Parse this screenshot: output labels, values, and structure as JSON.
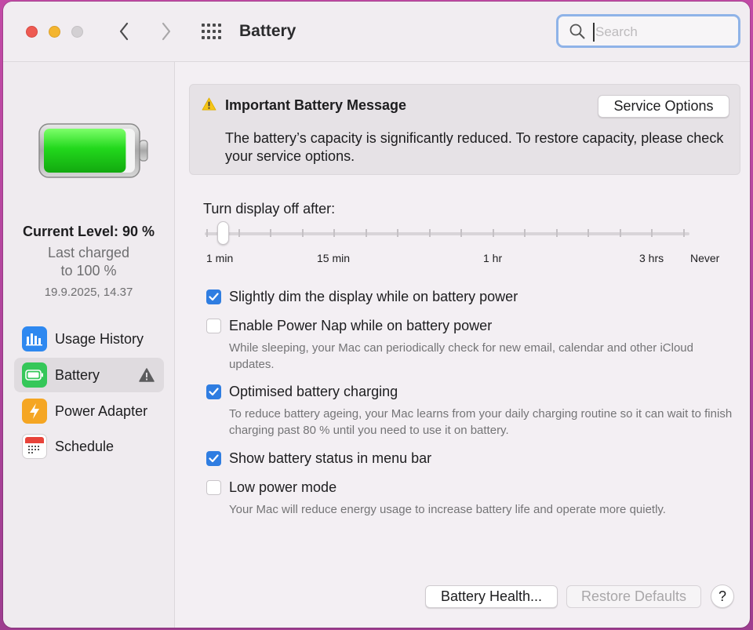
{
  "window": {
    "title": "Battery",
    "search_placeholder": "Search"
  },
  "sidebar": {
    "current_level": "Current Level: 90 %",
    "last_charged": "Last charged",
    "to_level": "to 100 %",
    "charged_date": "19.9.2025, 14.37",
    "battery_level": 0.9,
    "items": [
      {
        "label": "Usage History",
        "icon": "bar-chart-icon",
        "color": "#2e88f0"
      },
      {
        "label": "Battery",
        "icon": "battery-icon",
        "color": "#35c759",
        "selected": true,
        "warning": true
      },
      {
        "label": "Power Adapter",
        "icon": "lightning-icon",
        "color": "#f5a623"
      },
      {
        "label": "Schedule",
        "icon": "calendar-icon",
        "color": "#ffffff"
      }
    ]
  },
  "message": {
    "title": "Important Battery Message",
    "body": "The battery’s capacity is significantly reduced. To restore capacity, please check your service options.",
    "button": "Service Options"
  },
  "display_off": {
    "label": "Turn display off after:",
    "marks": [
      "1 min",
      "15 min",
      "1 hr",
      "3 hrs",
      "Never"
    ],
    "selected": "1 min"
  },
  "options": [
    {
      "label": "Slightly dim the display while on battery power",
      "checked": true
    },
    {
      "label": "Enable Power Nap while on battery power",
      "checked": false,
      "help": "While sleeping, your Mac can periodically check for new email, calendar and other iCloud updates."
    },
    {
      "label": "Optimised battery charging",
      "checked": true,
      "help": "To reduce battery ageing, your Mac learns from your daily charging routine so it can wait to finish charging past 80 % until you need to use it on battery."
    },
    {
      "label": "Show battery status in menu bar",
      "checked": true
    },
    {
      "label": "Low power mode",
      "checked": false,
      "help": "Your Mac will reduce energy usage to increase battery life and operate more quietly."
    }
  ],
  "footer": {
    "battery_health": "Battery Health...",
    "restore_defaults": "Restore Defaults",
    "help": "?"
  },
  "colors": {
    "accent": "#2f7de1",
    "battery_green": "#2ed62e",
    "warning": "#f5c518"
  }
}
